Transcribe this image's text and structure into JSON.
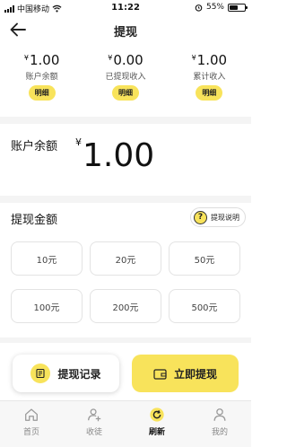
{
  "status_bar": {
    "carrier": "中国移动",
    "time": "11:22",
    "battery": "55%",
    "battery_level": 0.55
  },
  "header": {
    "title": "提现"
  },
  "stats": [
    {
      "currency": "¥",
      "value": "1.00",
      "label": "账户余额",
      "detail": "明细"
    },
    {
      "currency": "¥",
      "value": "0.00",
      "label": "已提现收入",
      "detail": "明细"
    },
    {
      "currency": "¥",
      "value": "1.00",
      "label": "累计收入",
      "detail": "明细"
    }
  ],
  "balance": {
    "label": "账户余额",
    "currency": "¥",
    "amount": "1.00"
  },
  "withdraw": {
    "heading": "提现金额",
    "help_label": "提现说明",
    "help_icon": "?",
    "amounts": [
      "10元",
      "20元",
      "50元",
      "100元",
      "200元",
      "500元"
    ]
  },
  "actions": {
    "record_label": "提现记录",
    "withdraw_label": "立即提现"
  },
  "tabs": [
    {
      "label": "首页",
      "icon": "home-icon"
    },
    {
      "label": "收徒",
      "icon": "add-user-icon"
    },
    {
      "label": "刷新",
      "icon": "refresh-icon"
    },
    {
      "label": "我的",
      "icon": "profile-icon"
    }
  ],
  "colors": {
    "accent": "#f8e35b"
  }
}
